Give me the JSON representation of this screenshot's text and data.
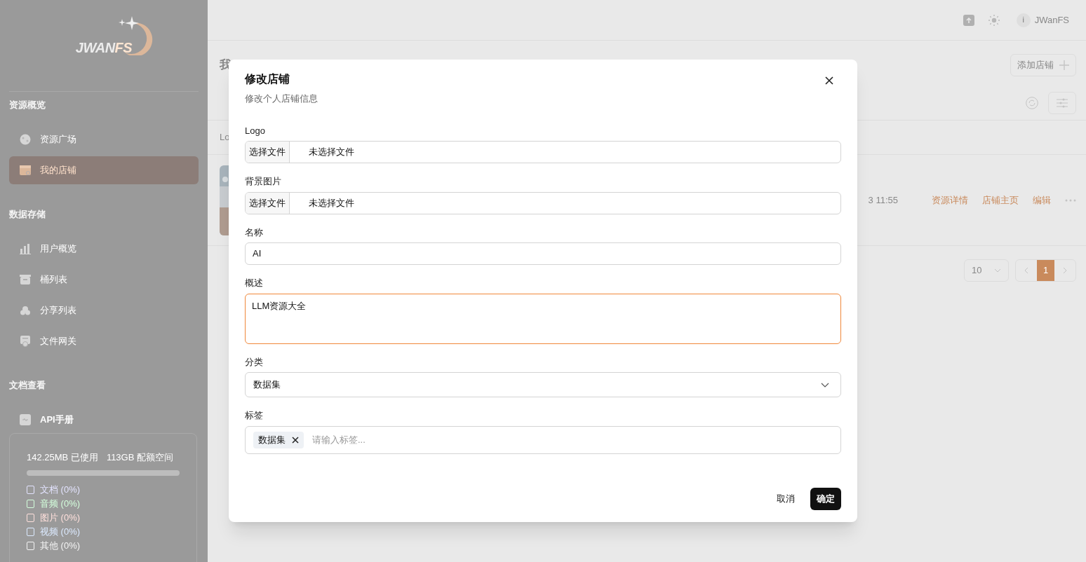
{
  "sidebar": {
    "logo": {
      "left": "JWAN",
      "right": "FS"
    },
    "sections": [
      {
        "title": "资源概览",
        "items": [
          {
            "label": "资源广场",
            "selected": false
          },
          {
            "label": "我的店铺",
            "selected": true
          }
        ]
      },
      {
        "title": "数据存储",
        "items": [
          {
            "label": "用户概览",
            "selected": false
          },
          {
            "label": "桶列表",
            "selected": false
          },
          {
            "label": "分享列表",
            "selected": false
          },
          {
            "label": "文件网关",
            "selected": false
          }
        ]
      },
      {
        "title": "文档查看",
        "items": [
          {
            "label": "API手册",
            "selected": false
          }
        ]
      }
    ],
    "storage": {
      "used": "142.25MB 已使用",
      "quota": "113GB 配额空间",
      "level": 0,
      "types": [
        {
          "label": "文档 (0%)",
          "color": "#e4e4ff"
        },
        {
          "label": "音频 (0%)",
          "color": "#d4ffdc"
        },
        {
          "label": "图片 (0%)",
          "color": "#ffe0dc"
        },
        {
          "label": "视频 (0%)",
          "color": "#dceaff"
        },
        {
          "label": "其他 (0%)",
          "color": "#f4f4f4"
        }
      ]
    }
  },
  "header": {
    "avatar": "i",
    "user": "JWanFS"
  },
  "page": {
    "title": "我",
    "add_button": "添加店铺",
    "column_header": "Lo",
    "row": {
      "time": "3 11:55",
      "actions": [
        "资源详情",
        "店铺主页",
        "编辑"
      ]
    },
    "pagination": {
      "page_size": "10",
      "pages": [
        {
          "label": "1",
          "selected": true
        }
      ]
    }
  },
  "dialog": {
    "title": "修改店铺",
    "subtitle": "修改个人店铺信息",
    "fields": [
      {
        "kind": "file",
        "label": "Logo",
        "button": "选择文件",
        "value": "未选择文件",
        "focused": false
      },
      {
        "kind": "file",
        "label": "背景图片",
        "button": "选择文件",
        "value": "未选择文件",
        "focused": false
      },
      {
        "kind": "text",
        "label": "名称",
        "value": "AI",
        "focused": false
      },
      {
        "kind": "textarea",
        "label": "概述",
        "value": "LLM资源大全",
        "focused": true
      },
      {
        "kind": "select",
        "label": "分类",
        "value": "数据集",
        "focused": false
      },
      {
        "kind": "tags",
        "label": "标签",
        "tags": [
          "数据集"
        ],
        "placeholder": "请输入标签...",
        "focused": false
      }
    ],
    "cancel": "取消",
    "confirm": "确定"
  }
}
